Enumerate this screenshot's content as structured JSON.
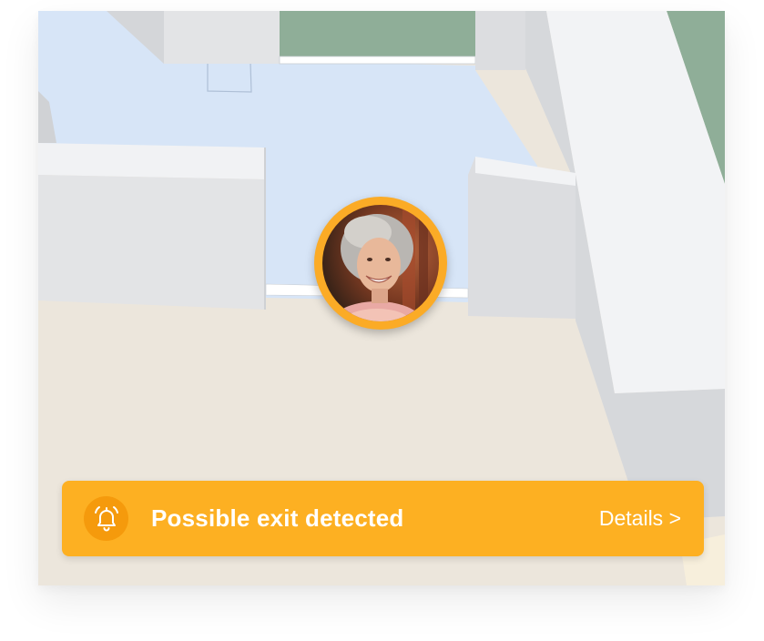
{
  "alert": {
    "message": "Possible exit detected",
    "details_link": "Details >",
    "icon": "bell-icon"
  },
  "resident": {
    "avatar": "resident-photo"
  },
  "colors": {
    "alert_bg": "#fdb022",
    "alert_icon_bg": "#f59a0c",
    "avatar_ring": "#fbab26",
    "floor_blue": "#d7e5f7",
    "floor_beige": "#ece6dc",
    "outdoor_green": "#8fae98",
    "wall": "#e6e7e9"
  }
}
